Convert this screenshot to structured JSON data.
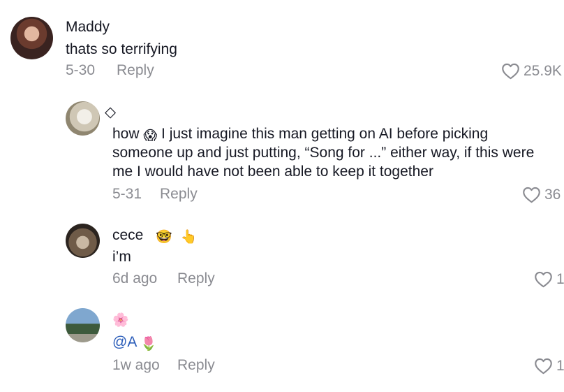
{
  "colors": {
    "text": "#161823",
    "muted": "#8a8b91",
    "mention": "#2b5db9"
  },
  "comments": [
    {
      "username": "Maddy",
      "text": "thats so terrifying",
      "date": "5-30",
      "reply_label": "Reply",
      "likes": "25.9K"
    },
    {
      "username": "◇",
      "text_prefix": "how",
      "text_emoji": "😱",
      "text": "I just imagine this man getting on AI before picking someone up and just putting, “Song for ...” either way, if this were me I would have not been able to keep it together",
      "date": "5-31",
      "reply_label": "Reply",
      "likes": "36"
    },
    {
      "username": "cece",
      "username_emojis": [
        "🤓",
        "👆"
      ],
      "text": "i’m",
      "date": "6d ago",
      "reply_label": "Reply",
      "likes": "1"
    },
    {
      "username": "🌸",
      "text": "@A",
      "text_emoji": "🌷",
      "date": "1w ago",
      "reply_label": "Reply",
      "likes": "1"
    }
  ]
}
